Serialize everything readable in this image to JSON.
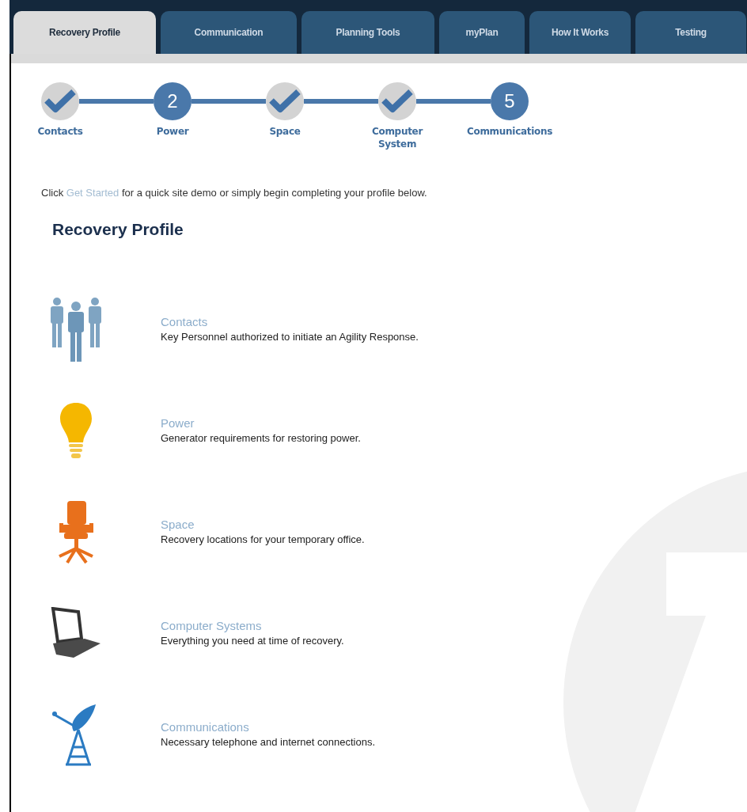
{
  "tabs": [
    {
      "label": "Recovery Profile",
      "selected": true
    },
    {
      "label": "Communication",
      "selected": false
    },
    {
      "label": "Planning Tools",
      "selected": false
    },
    {
      "label": "myPlan",
      "selected": false
    },
    {
      "label": "How It Works",
      "selected": false
    },
    {
      "label": "Testing",
      "selected": false
    }
  ],
  "steps": [
    {
      "label": "Contacts",
      "completed": true
    },
    {
      "label": "Power",
      "completed": false,
      "number": "2"
    },
    {
      "label": "Space",
      "completed": true
    },
    {
      "label": "Computer System",
      "completed": true
    },
    {
      "label": "Communications",
      "completed": false,
      "number": "5"
    }
  ],
  "intro": {
    "before": "Click",
    "link": "Get Started",
    "after": "for a quick site demo or simply begin completing your profile below."
  },
  "heading": "Recovery Profile",
  "profile_items": [
    {
      "kind": "people",
      "title": "Contacts",
      "description": "Key Personnel authorized to initiate an Agility Response."
    },
    {
      "kind": "bulb",
      "title": "Power",
      "description": "Generator requirements for restoring power."
    },
    {
      "kind": "chair",
      "title": "Space",
      "description": "Recovery locations for your temporary office."
    },
    {
      "kind": "laptop",
      "title": "Computer Systems",
      "description": "Everything you need at time of recovery."
    },
    {
      "kind": "satellite",
      "title": "Communications",
      "description": "Necessary telephone and internet connections."
    }
  ]
}
